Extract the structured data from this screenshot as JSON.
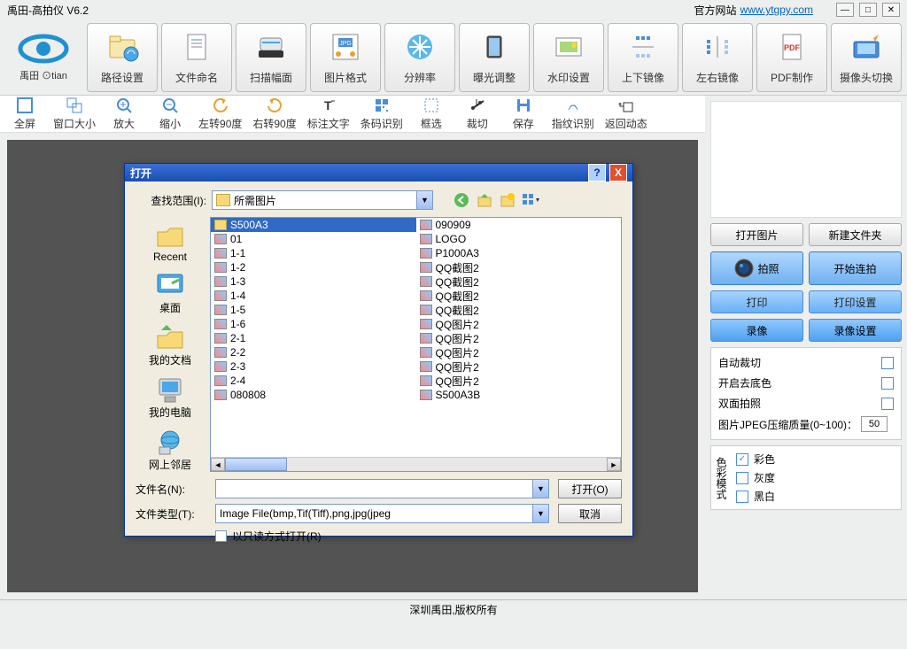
{
  "titlebar": {
    "title": "禹田-高拍仪 V6.2",
    "website_label": "官方网站",
    "website_url": "www.ytgpy.com"
  },
  "logo": {
    "text": "禹田 ⊙tian"
  },
  "toolbar": [
    {
      "id": "path-settings",
      "label": "路径设置"
    },
    {
      "id": "file-naming",
      "label": "文件命名"
    },
    {
      "id": "scan-area",
      "label": "扫描幅面"
    },
    {
      "id": "image-format",
      "label": "图片格式"
    },
    {
      "id": "resolution",
      "label": "分辨率"
    },
    {
      "id": "exposure",
      "label": "曝光调整"
    },
    {
      "id": "watermark",
      "label": "水印设置"
    },
    {
      "id": "flip-vertical",
      "label": "上下镜像"
    },
    {
      "id": "flip-horizontal",
      "label": "左右镜像"
    },
    {
      "id": "pdf-make",
      "label": "PDF制作"
    },
    {
      "id": "camera-switch",
      "label": "摄像头切换"
    }
  ],
  "sec_toolbar": [
    {
      "id": "fullscreen",
      "label": "全屏"
    },
    {
      "id": "window-size",
      "label": "窗口大小"
    },
    {
      "id": "zoom-in",
      "label": "放大"
    },
    {
      "id": "zoom-out",
      "label": "缩小"
    },
    {
      "id": "rotate-left",
      "label": "左转90度"
    },
    {
      "id": "rotate-right",
      "label": "右转90度"
    },
    {
      "id": "annotate",
      "label": "标注文字"
    },
    {
      "id": "barcode",
      "label": "条码识别"
    },
    {
      "id": "select-box",
      "label": "框选"
    },
    {
      "id": "crop",
      "label": "裁切"
    },
    {
      "id": "save",
      "label": "保存"
    },
    {
      "id": "fingerprint",
      "label": "指纹识别"
    },
    {
      "id": "return-dynamic",
      "label": "返回动态"
    }
  ],
  "side": {
    "open_image": "打开图片",
    "new_folder": "新建文件夹",
    "capture": "拍照",
    "start_burst": "开始连拍",
    "print": "打印",
    "print_settings": "打印设置",
    "record": "录像",
    "record_settings": "录像设置",
    "auto_crop": "自动裁切",
    "remove_bg": "开启去底色",
    "double_shoot": "双面拍照",
    "jpeg_label": "图片JPEG压缩质量(0~100)：",
    "jpeg_value": "50",
    "color_mode_title": "色彩模式",
    "color_color": "彩色",
    "color_gray": "灰度",
    "color_bw": "黑白"
  },
  "dialog": {
    "title": "打开",
    "lookin_label": "查找范围(I):",
    "lookin_value": "所需图片",
    "places": [
      {
        "id": "recent",
        "label": "Recent"
      },
      {
        "id": "desktop",
        "label": "桌面"
      },
      {
        "id": "mydocs",
        "label": "我的文档"
      },
      {
        "id": "mycomputer",
        "label": "我的电脑"
      },
      {
        "id": "network",
        "label": "网上邻居"
      }
    ],
    "files_col1": [
      {
        "name": "S500A3",
        "type": "folder",
        "selected": true
      },
      {
        "name": "01",
        "type": "image"
      },
      {
        "name": "1-1",
        "type": "image"
      },
      {
        "name": "1-2",
        "type": "image"
      },
      {
        "name": "1-3",
        "type": "image"
      },
      {
        "name": "1-4",
        "type": "image"
      },
      {
        "name": "1-5",
        "type": "image"
      },
      {
        "name": "1-6",
        "type": "image"
      },
      {
        "name": "2-1",
        "type": "image"
      },
      {
        "name": "2-2",
        "type": "image"
      },
      {
        "name": "2-3",
        "type": "image"
      },
      {
        "name": "2-4",
        "type": "image"
      },
      {
        "name": "080808",
        "type": "image"
      }
    ],
    "files_col2": [
      {
        "name": "090909",
        "type": "image"
      },
      {
        "name": "LOGO",
        "type": "image"
      },
      {
        "name": "P1000A3",
        "type": "image"
      },
      {
        "name": "QQ截图2",
        "type": "image"
      },
      {
        "name": "QQ截图2",
        "type": "image"
      },
      {
        "name": "QQ截图2",
        "type": "image"
      },
      {
        "name": "QQ截图2",
        "type": "image"
      },
      {
        "name": "QQ图片2",
        "type": "image"
      },
      {
        "name": "QQ图片2",
        "type": "image"
      },
      {
        "name": "QQ图片2",
        "type": "image"
      },
      {
        "name": "QQ图片2",
        "type": "image"
      },
      {
        "name": "QQ图片2",
        "type": "image"
      },
      {
        "name": "S500A3B",
        "type": "image"
      }
    ],
    "filename_label": "文件名(N):",
    "filename_value": "",
    "filetype_label": "文件类型(T):",
    "filetype_value": "Image File(bmp,Tif(Tiff),png,jpg(jpeg",
    "open_btn": "打开(O)",
    "cancel_btn": "取消",
    "readonly_label": "以只读方式打开(R)"
  },
  "footer": {
    "copyright": "深圳禹田,版权所有"
  }
}
